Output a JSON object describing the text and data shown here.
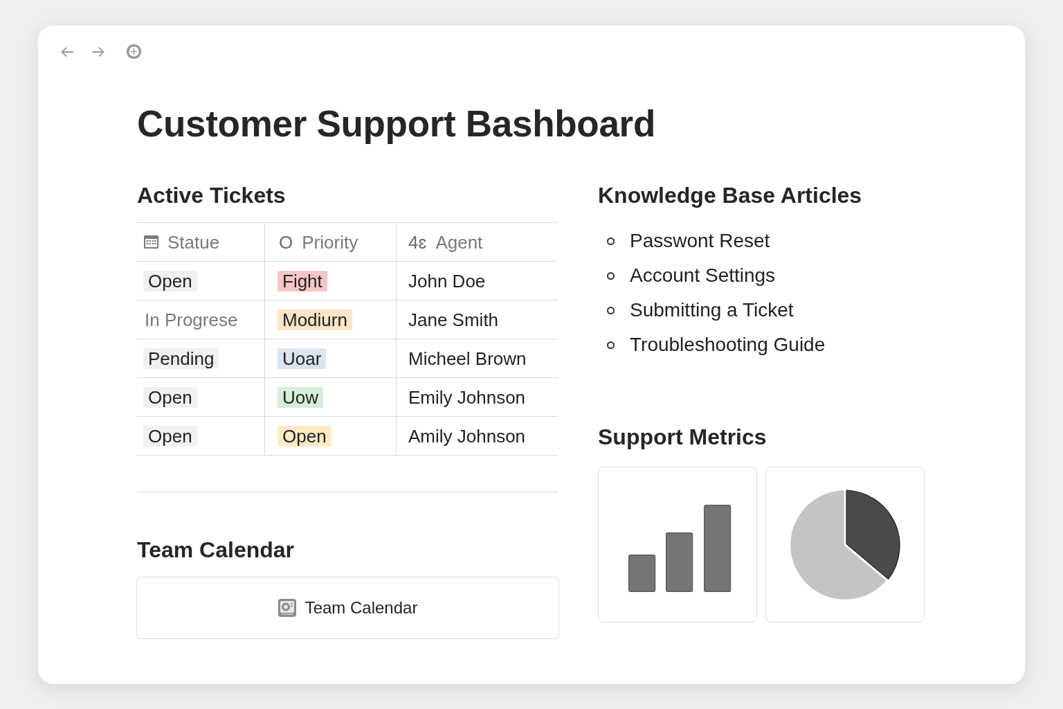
{
  "page": {
    "title": "Customer Support Bashboard"
  },
  "active_tickets": {
    "heading": "Active Tickets",
    "columns": [
      {
        "kind": "icon",
        "label": "Statue"
      },
      {
        "kind": "glyph",
        "prefix": "O",
        "label": "Priority"
      },
      {
        "kind": "glyph",
        "prefix": "4ɛ",
        "label": "Agent"
      }
    ],
    "rows": [
      {
        "status": {
          "kind": "tag",
          "text": "Open"
        },
        "priority": {
          "text": "Fight",
          "color": "#f8c6c7"
        },
        "agent": "John Doe"
      },
      {
        "status": {
          "kind": "text",
          "text": "In Progrese"
        },
        "priority": {
          "text": "Modiurn",
          "color": "#fce4c6"
        },
        "agent": "Jane Smith"
      },
      {
        "status": {
          "kind": "tag",
          "text": "Pending"
        },
        "priority": {
          "text": "Uoar",
          "color": "#dbe4ef"
        },
        "agent": "Micheel Brown"
      },
      {
        "status": {
          "kind": "tag",
          "text": "Open"
        },
        "priority": {
          "text": "Uow",
          "color": "#d4eed8"
        },
        "agent": "Emily Johnson"
      },
      {
        "status": {
          "kind": "tag",
          "text": "Open"
        },
        "priority": {
          "text": "Open",
          "color": "#fdeac6"
        },
        "agent": "Amily Johnson"
      }
    ]
  },
  "team_calendar": {
    "heading": "Team Calendar",
    "embed": {
      "label": "Team Calendar"
    }
  },
  "knowledge_base": {
    "heading": "Knowledge Base Articles",
    "items": [
      "Passwont Reset",
      "Account Settings",
      "Submitting a Ticket",
      "Troubleshooting Guide"
    ]
  },
  "support_metrics": {
    "heading": "Support Metrics",
    "charts": [
      {
        "kind": "bar"
      },
      {
        "kind": "pie"
      }
    ]
  }
}
